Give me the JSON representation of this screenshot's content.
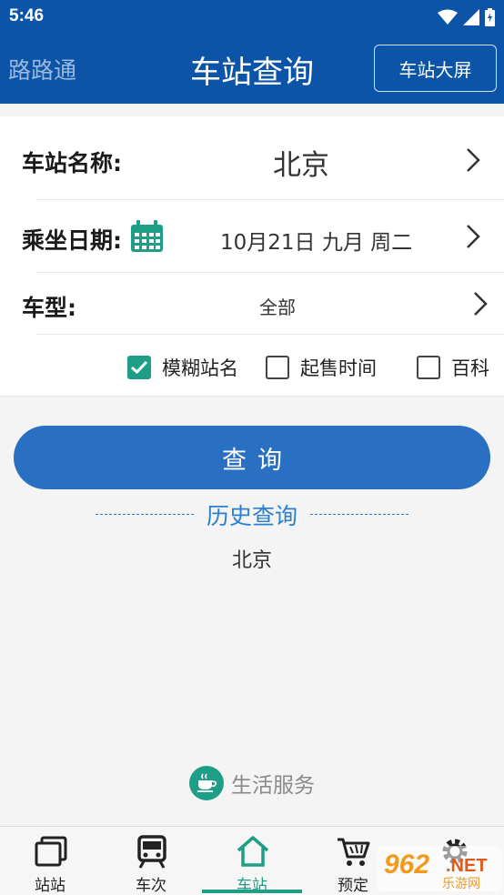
{
  "status": {
    "time": "5:46"
  },
  "header": {
    "brand": "路路通",
    "title": "车站查询",
    "screen_button": "车站大屏"
  },
  "form": {
    "station": {
      "label": "车站名称:",
      "value": "北京"
    },
    "date": {
      "label": "乘坐日期:",
      "value": "10月21日 九月 周二"
    },
    "train_type": {
      "label": "车型:",
      "value": "全部"
    },
    "options": [
      {
        "label": "模糊站名",
        "checked": true
      },
      {
        "label": "起售时间",
        "checked": false
      },
      {
        "label": "百科",
        "checked": false
      }
    ]
  },
  "query_button": "查询",
  "history": {
    "title": "历史查询",
    "items": [
      "北京"
    ]
  },
  "life_service": "生活服务",
  "nav": {
    "items": [
      {
        "label": "站站",
        "icon": "station-to-station-icon"
      },
      {
        "label": "车次",
        "icon": "train-icon"
      },
      {
        "label": "车站",
        "icon": "home-icon"
      },
      {
        "label": "预定",
        "icon": "cart-icon"
      },
      {
        "label": "",
        "icon": "gear-icon"
      }
    ],
    "active_index": 2
  },
  "watermark": "962.NET 乐游网",
  "colors": {
    "primary": "#0b54a8",
    "accent": "#1e9e86",
    "button": "#2a70c2",
    "link": "#2a7fd0"
  }
}
